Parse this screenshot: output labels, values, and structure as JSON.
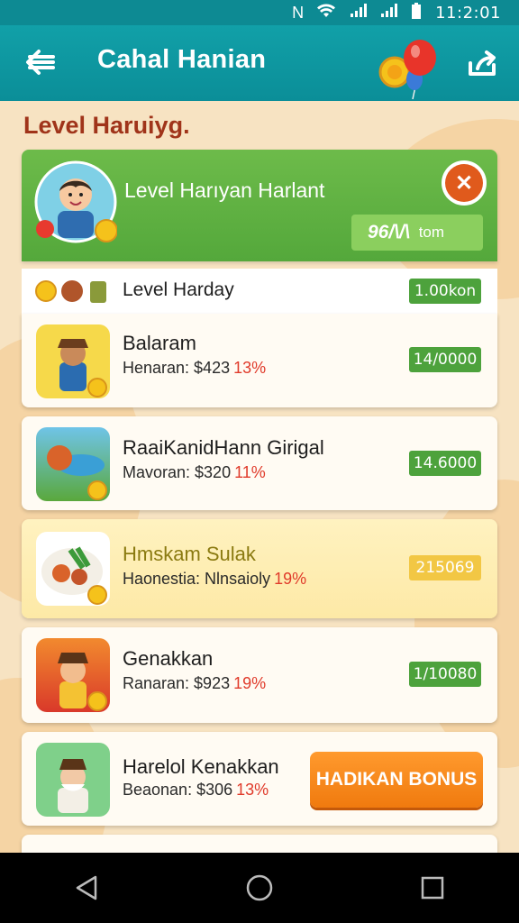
{
  "status_bar": {
    "time": "11:2:01"
  },
  "app_bar": {
    "title": "Cahal Hanian"
  },
  "section": {
    "title": "Level Haruiyg."
  },
  "header": {
    "title": "Level Harıyan Harlant",
    "score_value": "96/\\/\\",
    "score_unit": "tom"
  },
  "level_row": {
    "label": "Level Harday",
    "value": "1.00kon"
  },
  "items": [
    {
      "title": "Balaram",
      "sub_text": "Henaran: $423",
      "sub_pct": "13%",
      "value": "14/0000"
    },
    {
      "title": "RaaiKanidHann Girigal",
      "sub_text": "Mavoran: $320",
      "sub_pct": "11%",
      "value": "14.6000"
    },
    {
      "title": "Hmskam Sulak",
      "sub_text": "Haonestia: Nlnsaioly",
      "sub_pct": "19%",
      "value": "215069"
    },
    {
      "title": "Genakkan",
      "sub_text": "Ranaran: $923",
      "sub_pct": "19%",
      "value": "1/10080"
    },
    {
      "title": "Harelol Kenakkan",
      "sub_text": "Beaonan: $306",
      "sub_pct": "13%",
      "button": "HADIKAN BONUS"
    }
  ],
  "colors": {
    "teal": "#0b8e98",
    "green": "#54a83b",
    "orange": "#f07a0e",
    "title_red": "#a0341a"
  }
}
